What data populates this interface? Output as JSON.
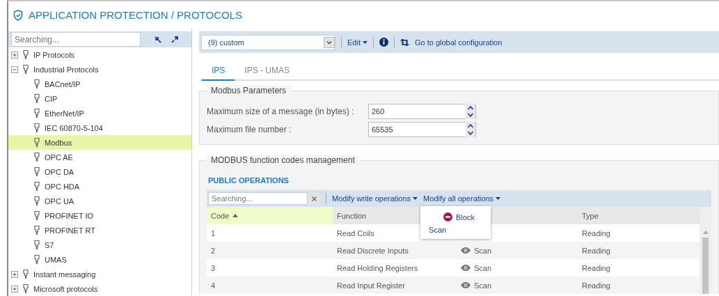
{
  "title": "APPLICATION PROTECTION / PROTOCOLS",
  "tree": {
    "search_placeholder": "Searching...",
    "items": [
      {
        "label": "IP Protocols",
        "expanded": false,
        "selected": false
      },
      {
        "label": "Industrial Protocols",
        "expanded": true,
        "selected": false,
        "children": [
          {
            "label": "BACnet/IP",
            "selected": false
          },
          {
            "label": "CIP",
            "selected": false
          },
          {
            "label": "EtherNet/IP",
            "selected": false
          },
          {
            "label": "IEC 60870-5-104",
            "selected": false
          },
          {
            "label": "Modbus",
            "selected": true
          },
          {
            "label": "OPC AE",
            "selected": false
          },
          {
            "label": "OPC DA",
            "selected": false
          },
          {
            "label": "OPC HDA",
            "selected": false
          },
          {
            "label": "OPC UA",
            "selected": false
          },
          {
            "label": "PROFINET IO",
            "selected": false
          },
          {
            "label": "PROFINET RT",
            "selected": false
          },
          {
            "label": "S7",
            "selected": false
          },
          {
            "label": "UMAS",
            "selected": false
          }
        ]
      },
      {
        "label": "Instant messaging",
        "expanded": false,
        "selected": false
      },
      {
        "label": "Microsoft protocols",
        "expanded": false,
        "selected": false
      }
    ]
  },
  "toolbar": {
    "profile": "(9) custom",
    "edit": "Edit",
    "global_link": "Go to global configuration"
  },
  "tabs": [
    {
      "label": "IPS",
      "selected": true
    },
    {
      "label": "IPS - UMAS",
      "selected": false
    }
  ],
  "modbus_parameters": {
    "legend": "Modbus Parameters",
    "fields": [
      {
        "label": "Maximum size of a message (in bytes) :",
        "value": "260"
      },
      {
        "label": "Maximum file number :",
        "value": "65535"
      }
    ]
  },
  "function_codes": {
    "legend": "MODBUS function codes management",
    "section": "PUBLIC OPERATIONS",
    "search_placeholder": "Searching...",
    "menus": [
      "Modify write operations",
      "Modify all operations"
    ],
    "dropdown": [
      {
        "label": "Block",
        "kind": "block"
      },
      {
        "label": "Scan",
        "kind": "scan"
      }
    ],
    "table": {
      "columns": [
        {
          "label": "Code",
          "sorted": true
        },
        {
          "label": "Function",
          "sorted": false
        },
        {
          "label": "Type",
          "sorted": false
        }
      ],
      "rows": [
        {
          "code": "1",
          "function": "Read Coils",
          "type": "Reading"
        },
        {
          "code": "2",
          "function": "Read Discrete Inputs",
          "action": "Scan",
          "type": "Reading"
        },
        {
          "code": "3",
          "function": "Read Holding Registers",
          "action": "Scan",
          "type": "Reading"
        },
        {
          "code": "4",
          "function": "Read Input Register",
          "action": "Scan",
          "type": "Reading"
        }
      ]
    }
  }
}
